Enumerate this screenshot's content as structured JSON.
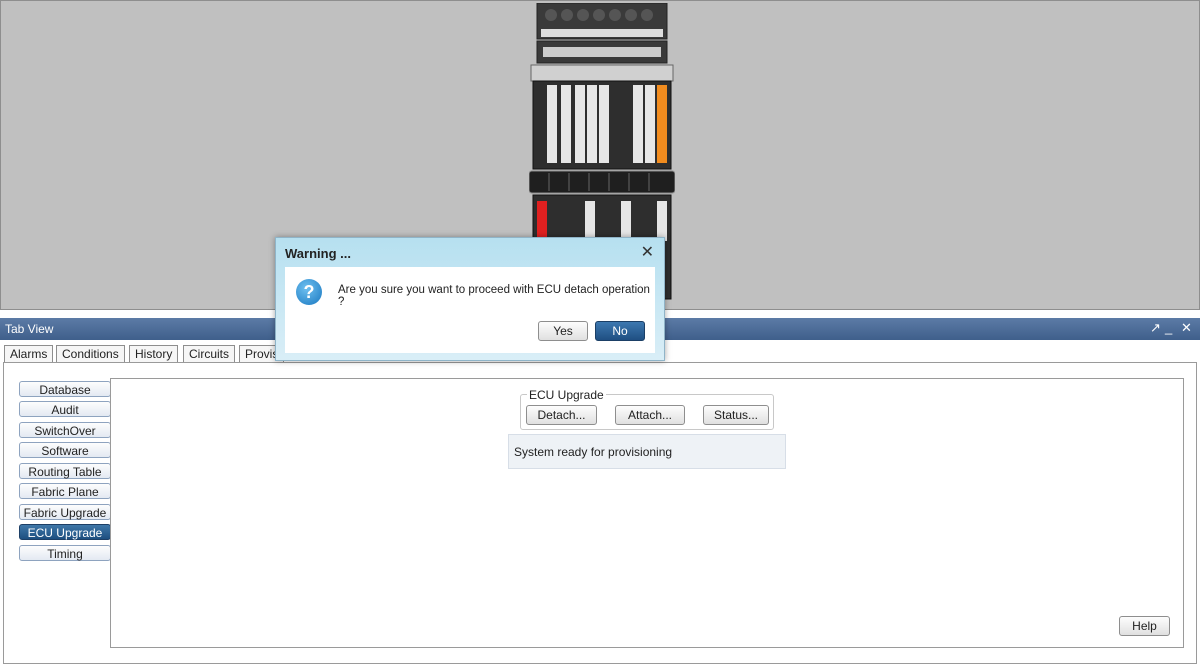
{
  "tabview": {
    "title": "Tab View"
  },
  "tabs": [
    {
      "label": "Alarms"
    },
    {
      "label": "Conditions"
    },
    {
      "label": "History"
    },
    {
      "label": "Circuits"
    },
    {
      "label": "Provis"
    }
  ],
  "sidebar": {
    "items": [
      {
        "label": "Database"
      },
      {
        "label": "Audit"
      },
      {
        "label": "SwitchOver"
      },
      {
        "label": "Software"
      },
      {
        "label": "Routing Table"
      },
      {
        "label": "Fabric Plane"
      },
      {
        "label": "Fabric Upgrade"
      },
      {
        "label": "ECU Upgrade"
      },
      {
        "label": "Timing"
      }
    ],
    "active": "ECU Upgrade"
  },
  "ecu_upgrade": {
    "group_title": "ECU Upgrade",
    "detach_label": "Detach...",
    "attach_label": "Attach...",
    "status_label": "Status...",
    "status_text": "System ready for provisioning"
  },
  "help_label": "Help",
  "dialog": {
    "title": "Warning ...",
    "message": "Are you sure you want to proceed with ECU detach operation ?",
    "yes_label": "Yes",
    "no_label": "No",
    "icon": "question-icon"
  },
  "colors": {
    "header_bg": "#4a6a96",
    "active_nav": "#2a5f92",
    "dialog_title_bg": "#c4e6f3",
    "shelf_bg": "#c0c0c0"
  }
}
